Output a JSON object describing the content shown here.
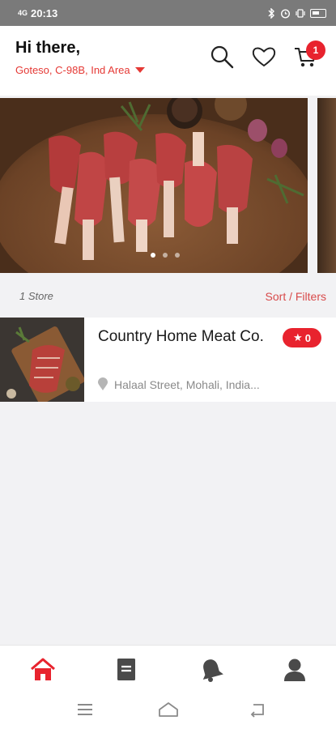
{
  "status_bar": {
    "network": "4G",
    "time": "20:13"
  },
  "header": {
    "greeting": "Hi there,",
    "location": "Goteso, C-98B, Ind Area",
    "cart_count": "1"
  },
  "banner": {
    "slide_count": 3,
    "active_slide": 1
  },
  "list_bar": {
    "store_count": "1 Store",
    "sort_filters": "Sort / Filters"
  },
  "stores": [
    {
      "name": "Country Home Meat Co.",
      "rating": "0",
      "address": "Halaal Street, Mohali, India..."
    }
  ],
  "bottom_nav": [
    "home-icon",
    "orders-icon",
    "notifications-icon",
    "profile-icon"
  ],
  "colors": {
    "accent": "#e8232e",
    "accent_text": "#e53935",
    "nav_inactive": "#4a4a4a"
  }
}
